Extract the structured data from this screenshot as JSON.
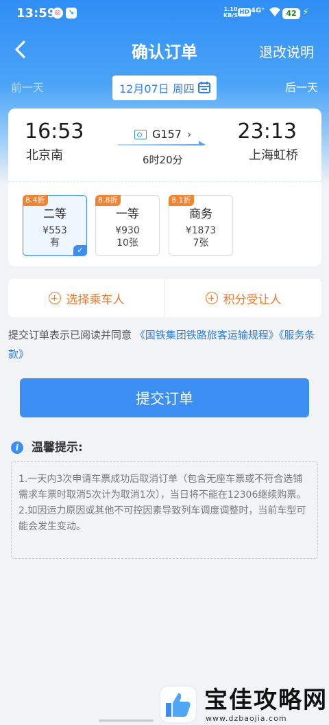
{
  "status_bar": {
    "time": "13:59",
    "speed_value": "1.10",
    "speed_unit": "KB/S",
    "hd": "HD",
    "network": "4G⁺",
    "battery": "42"
  },
  "nav": {
    "title": "确认订单",
    "right_action": "退改说明"
  },
  "date_bar": {
    "prev": "前一天",
    "date": "12月07日 周四",
    "next": "后一天"
  },
  "train": {
    "depart_time": "16:53",
    "depart_station": "北京南",
    "train_no": "G157",
    "duration": "6时20分",
    "arrive_time": "23:13",
    "arrive_station": "上海虹桥"
  },
  "seats": [
    {
      "discount": "8.4折",
      "name": "二等",
      "price": "¥553",
      "availability": "有",
      "selected": true
    },
    {
      "discount": "8.8折",
      "name": "一等",
      "price": "¥930",
      "availability": "10张",
      "selected": false
    },
    {
      "discount": "8.1折",
      "name": "商务",
      "price": "¥1873",
      "availability": "7张",
      "selected": false
    }
  ],
  "actions": {
    "select_passenger": "选择乘车人",
    "points_recipient": "积分受让人"
  },
  "agreement": {
    "text": "提交订单表示已阅读并同意",
    "link1": "《国铁集团铁路旅客运输规程》",
    "link2": "《服务条款》"
  },
  "submit_label": "提交订单",
  "tips": {
    "title": "温馨提示:",
    "line1": "1.一天内3次申请车票成功后取消订单（包含无座车票或不符合选铺需求车票时取消5次计为取消1次），当日将不能在12306继续购票。",
    "line2": "2.如因运力原因或其他不可控因素导致列车调度调整时，当前车型可能会发生变动。"
  },
  "watermark": {
    "title": "宝佳攻略网",
    "url": "www.dzbaojia.com"
  },
  "colors": {
    "primary": "#3b8ff3",
    "accent_orange": "#f0782a",
    "discount_badge": "#f3832e",
    "page_bg": "#f2f3f5"
  }
}
